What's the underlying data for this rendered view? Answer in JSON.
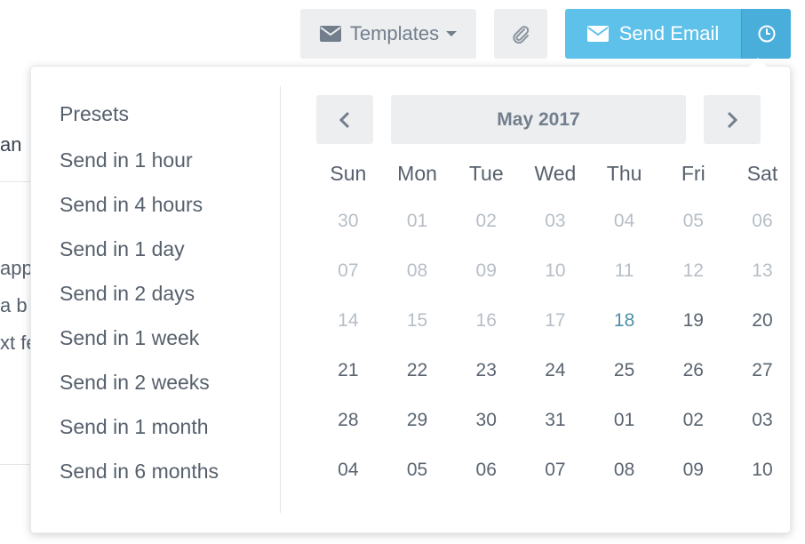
{
  "background": {
    "fragments": [
      "an",
      "app",
      "a b",
      "xt fe"
    ]
  },
  "toolbar": {
    "templates_label": "Templates",
    "send_label": "Send Email",
    "accent_color": "#5ec1ea"
  },
  "presets": {
    "title": "Presets",
    "items": [
      "Send in 1 hour",
      "Send in 4 hours",
      "Send in 1 day",
      "Send in 2 days",
      "Send in 1 week",
      "Send in 2 weeks",
      "Send in 1 month",
      "Send in 6 months"
    ]
  },
  "calendar": {
    "month_label": "May 2017",
    "weekdays": [
      "Sun",
      "Mon",
      "Tue",
      "Wed",
      "Thu",
      "Fri",
      "Sat"
    ],
    "today": "18",
    "weeks": [
      [
        "30",
        "01",
        "02",
        "03",
        "04",
        "05",
        "06"
      ],
      [
        "07",
        "08",
        "09",
        "10",
        "11",
        "12",
        "13"
      ],
      [
        "14",
        "15",
        "16",
        "17",
        "18",
        "19",
        "20"
      ],
      [
        "21",
        "22",
        "23",
        "24",
        "25",
        "26",
        "27"
      ],
      [
        "28",
        "29",
        "30",
        "31",
        "01",
        "02",
        "03"
      ],
      [
        "04",
        "05",
        "06",
        "07",
        "08",
        "09",
        "10"
      ]
    ],
    "disabled_before_today": true
  },
  "icons": {
    "templates": "envelope-icon",
    "attach": "paperclip-icon",
    "send": "envelope-icon",
    "schedule": "clock-icon",
    "prev": "chevron-left-icon",
    "next": "chevron-right-icon"
  }
}
